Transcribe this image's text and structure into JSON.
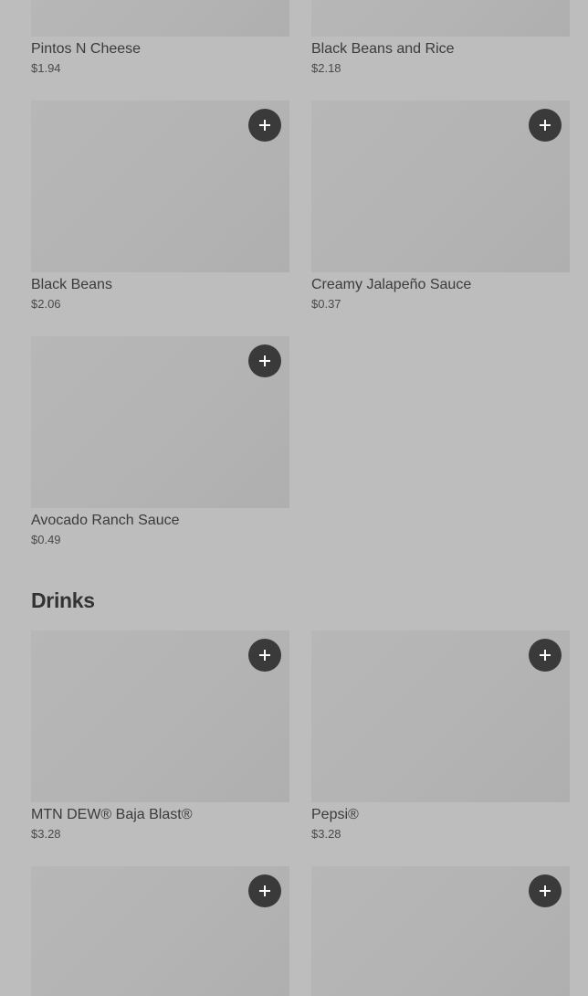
{
  "top_items": [
    {
      "name": "Pintos N Cheese",
      "price": "$1.94"
    },
    {
      "name": "Black Beans and Rice",
      "price": "$2.18"
    }
  ],
  "sides_items": [
    {
      "name": "Black Beans",
      "price": "$2.06"
    },
    {
      "name": "Creamy Jalapeño Sauce",
      "price": "$0.37"
    },
    {
      "name": "Avocado Ranch Sauce",
      "price": "$0.49"
    }
  ],
  "drinks": {
    "title": "Drinks",
    "items": [
      {
        "name": "MTN DEW® Baja Blast®",
        "price": "$3.28"
      },
      {
        "name": "Pepsi®",
        "price": "$3.28"
      }
    ]
  },
  "icons": {
    "add": "plus-icon"
  },
  "colors": {
    "background": "#bdbdbd",
    "thumbnail": "#b5b5b5",
    "button": "#3a3a3a",
    "button_icon": "#ffffff",
    "text": "#3b3b3b"
  }
}
